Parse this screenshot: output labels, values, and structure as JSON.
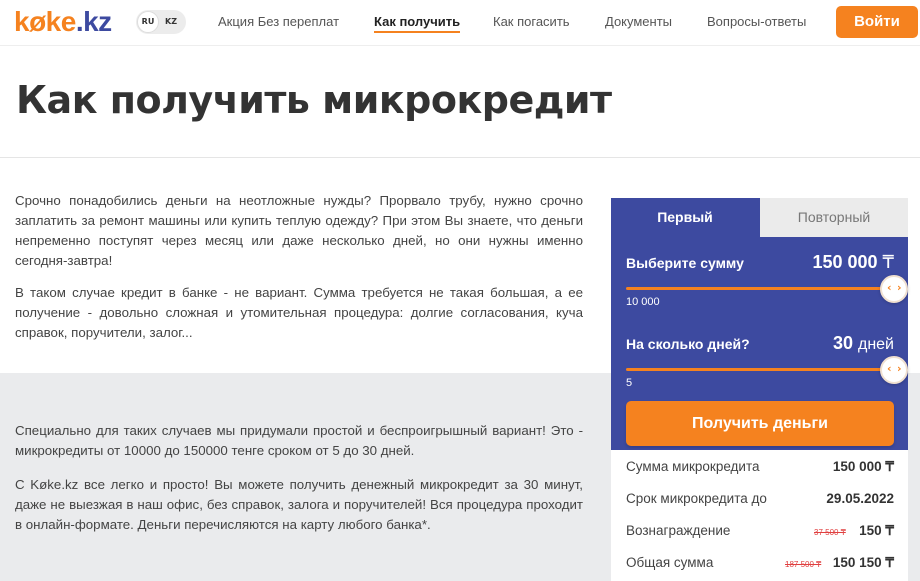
{
  "header": {
    "logo_main": "køke",
    "logo_suffix": ".kz",
    "lang_ru": "RU",
    "lang_kz": "KZ",
    "nav": [
      "Акция Без переплат",
      "Как получить",
      "Как погасить",
      "Документы",
      "Вопросы-ответы"
    ],
    "active_nav": "Как получить",
    "login": "Войти"
  },
  "page": {
    "title": "Как получить микрокредит",
    "paragraphs": [
      "Срочно понадобились деньги на неотложные нужды? Прорвало трубу, нужно срочно заплатить за ремонт машины или купить теплую одежду? При этом Вы знаете, что деньги непременно поступят через месяц или даже несколько дней, но они нужны именно сегодня-завтра!",
      "В таком случае кредит в банке - не вариант. Сумма требуется не такая большая, а ее получение - довольно сложная и утомительная процедура: долгие согласования, куча справок, поручители, залог...",
      "Специально для таких случаев мы придумали простой и беспроигрышный вариант! Это - микрокредиты от 10000 до 150000 тенге сроком от 5 до 30 дней.",
      "С Køke.kz все легко и просто! Вы можете получить денежный микрокредит за 30 минут, даже не выезжая в наш офис, без справок, залога и поручителей! Вся процедура проходит в онлайн-формате. Деньги перечисляются на карту любого банка*."
    ]
  },
  "calculator": {
    "tab_first": "Первый",
    "tab_repeat": "Повторный",
    "amount_label": "Выберите сумму",
    "amount_value": "150 000",
    "amount_unit": "₸",
    "amount_min": "10 000",
    "amount_slider_fraction": 1.0,
    "days_label": "На сколько дней?",
    "days_value": "30",
    "days_unit": "дней",
    "days_min": "5",
    "days_slider_fraction": 1.0,
    "button": "Получить деньги",
    "summary": [
      {
        "label": "Сумма микрокредита",
        "value": "150 000 ₸",
        "old": ""
      },
      {
        "label": "Срок микрокредита до",
        "value": "29.05.2022",
        "old": ""
      },
      {
        "label": "Вознаграждение",
        "value": "150 ₸",
        "old": "37 500 ₸"
      },
      {
        "label": "Общая сумма",
        "value": "150 150 ₸",
        "old": "187 500 ₸"
      }
    ]
  },
  "colors": {
    "accent": "#f5821f",
    "brand_blue": "#3d4aa0"
  }
}
